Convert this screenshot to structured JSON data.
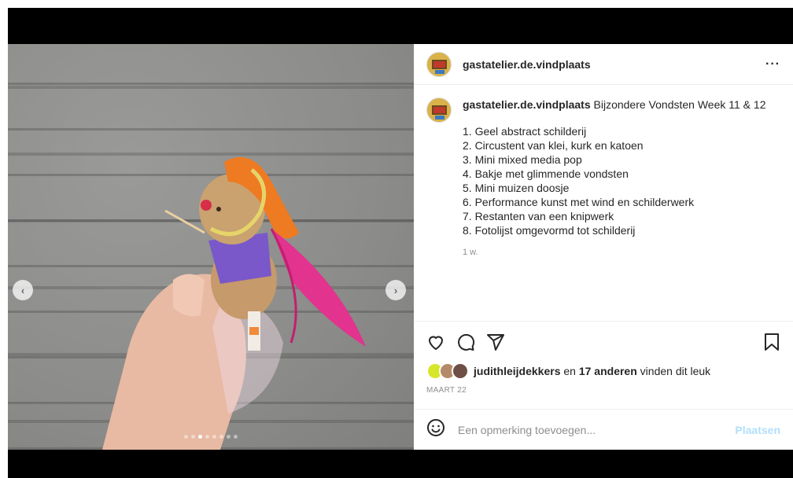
{
  "post": {
    "username": "gastatelier.de.vindplaats",
    "more_label": "···",
    "caption": {
      "username": "gastatelier.de.vindplaats",
      "text": "Bijzondere Vondsten Week 11 & 12",
      "items": [
        "1. Geel abstract schilderij",
        "2. Circustent van klei, kurk en katoen",
        "3. Mini mixed media pop",
        "4. Bakje met glimmende vondsten",
        "5. Mini muizen doosje",
        "6. Performance kunst met wind en schilderwerk",
        "7. Restanten van een knipwerk",
        "8. Fotolijst omgevormd tot schilderij"
      ],
      "age": "1 w."
    },
    "likes": {
      "user": "judithleijdekkers",
      "connector": " en ",
      "others": "17 anderen",
      "suffix": " vinden dit leuk"
    },
    "date": "MAART 22",
    "comment": {
      "placeholder": "Een opmerking toevoegen...",
      "post_label": "Plaatsen"
    },
    "carousel": {
      "count": 8,
      "active_index": 2,
      "prev_label": "‹",
      "next_label": "›"
    }
  },
  "colors": {
    "accent_disabled": "#b2dffc",
    "muted": "#8e8e8e"
  }
}
